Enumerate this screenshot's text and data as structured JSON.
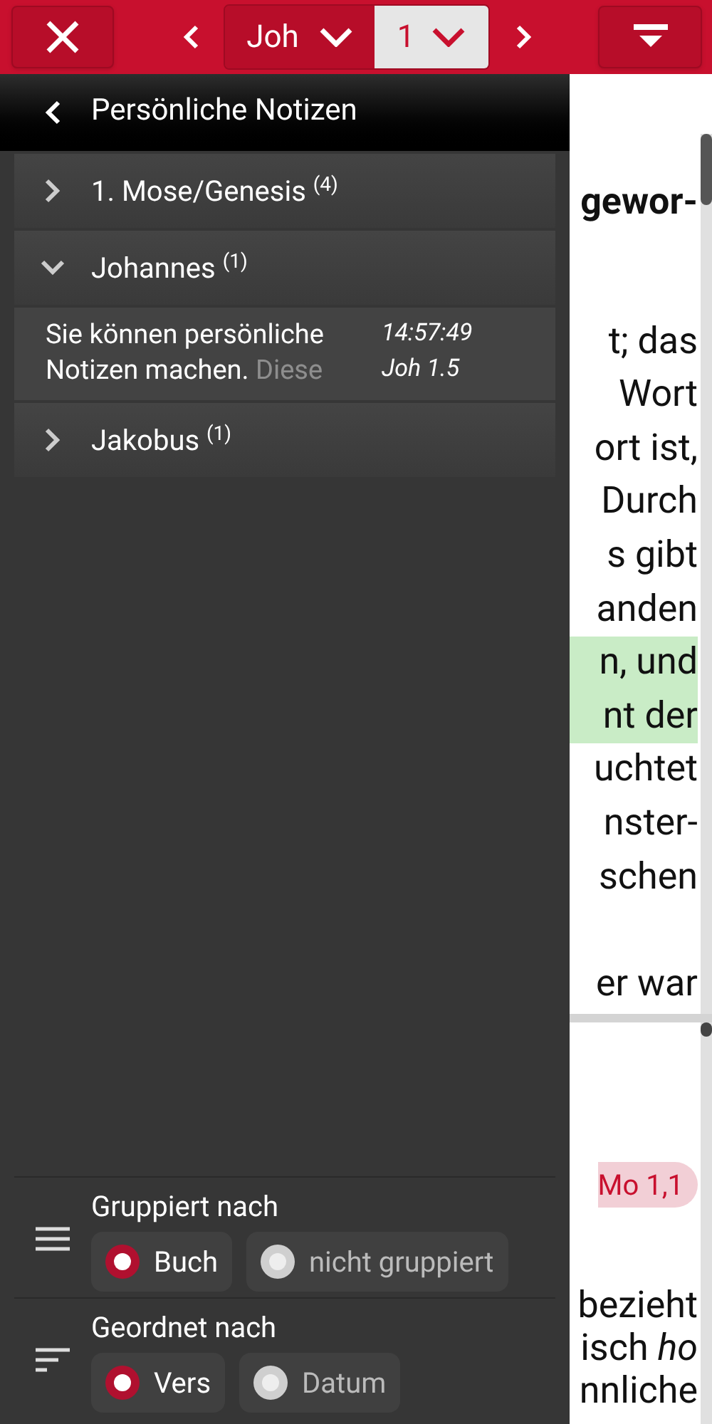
{
  "top_bar": {
    "book": "Joh",
    "chapter": "1"
  },
  "drawer": {
    "title": "Persönliche Notizen",
    "groups": [
      {
        "label": "1. Mose/Genesis $^{(4)}$",
        "expanded": false
      },
      {
        "label": "Johannes $^{(1)}$",
        "expanded": true,
        "notes": [
          {
            "text": "Sie können persönliche Notizen machen.",
            "faded_text": "Diese",
            "time": "14:57:49",
            "ref": "Joh 1.5"
          }
        ]
      },
      {
        "label": "Jakobus $^{(1)}$",
        "expanded": false
      }
    ],
    "settings": [
      {
        "kind": "group",
        "label": "Gruppiert nach",
        "options": [
          {
            "label": "Buch",
            "selected": true
          },
          {
            "label": "nicht gruppiert",
            "selected": false
          }
        ]
      },
      {
        "kind": "order",
        "label": "Geordnet nach",
        "options": [
          {
            "label": "Vers",
            "selected": true
          },
          {
            "label": "Datum",
            "selected": false
          }
        ]
      }
    ]
  },
  "reading": {
    "paragraphs": [
      {
        "kind": "heading",
        "lines": [
          {
            "text": "gewor-",
            "highlighted": false
          }
        ]
      },
      {
        "kind": "text",
        "lines": [
          {
            "text": "t; das",
            "highlighted": false
          },
          {
            "text": "Wort",
            "highlighted": false
          },
          {
            "text": "ort ist,",
            "highlighted": false
          },
          {
            "text": "Durch",
            "highlighted": false
          },
          {
            "text": "s gibt",
            "highlighted": false
          },
          {
            "text": "anden",
            "highlighted": false
          },
          {
            "text": "n, und",
            "highlighted": true
          },
          {
            "text": "nt der",
            "highlighted": true
          },
          {
            "text": "uchtet",
            "highlighted": false
          },
          {
            "text": "nster-",
            "highlighted": false
          },
          {
            "text": "schen",
            "highlighted": false
          }
        ]
      },
      {
        "kind": "text",
        "lines": [
          {
            "text": "er war",
            "highlighted": false
          }
        ]
      }
    ],
    "lower_pane": {
      "reference": "Mo 1,1",
      "lines": [
        "bezieht",
        "isch *ho*",
        "nnliche"
      ]
    }
  }
}
